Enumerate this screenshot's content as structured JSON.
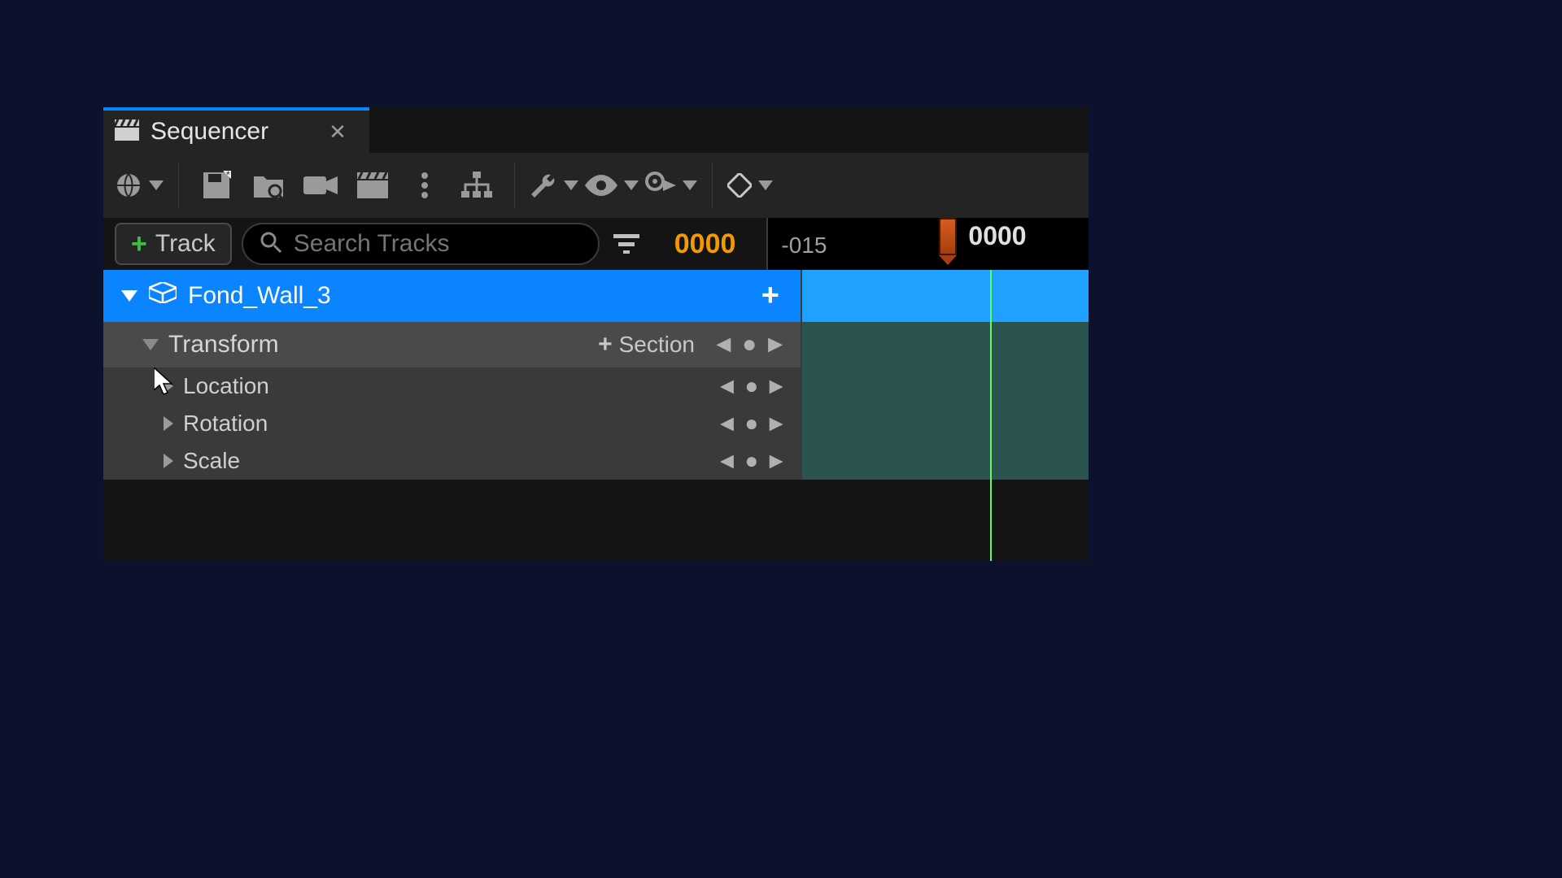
{
  "tab": {
    "title": "Sequencer"
  },
  "toolbar": {},
  "trackBar": {
    "addTrackLabel": "Track",
    "searchPlaceholder": "Search Tracks",
    "currentFrame": "0000"
  },
  "timeline": {
    "startLabel": "-015",
    "playheadFrame": "0000"
  },
  "object": {
    "name": "Fond_Wall_3"
  },
  "transform": {
    "label": "Transform",
    "sectionLabel": "Section",
    "children": [
      {
        "label": "Location"
      },
      {
        "label": "Rotation"
      },
      {
        "label": "Scale"
      }
    ]
  }
}
